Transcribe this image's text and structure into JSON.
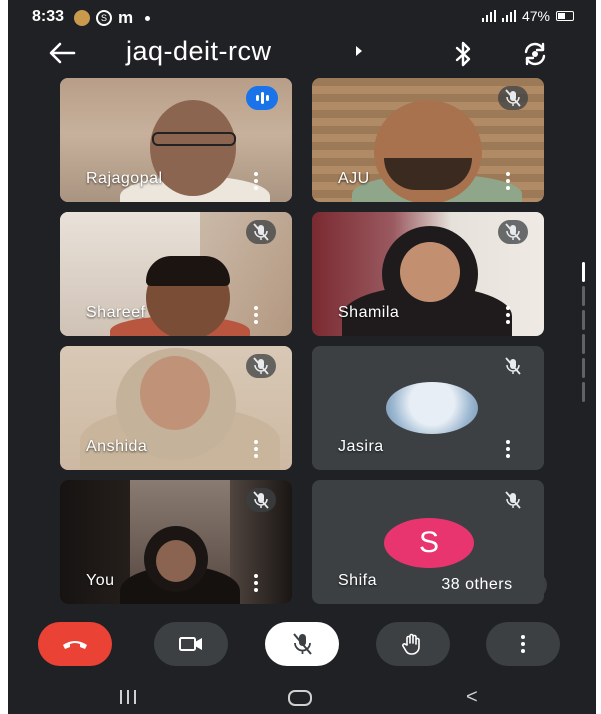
{
  "status_bar": {
    "time": "8:33",
    "m_icon": "m",
    "battery": "47%"
  },
  "header": {
    "title": "jaq-deit-rcw"
  },
  "participants": [
    {
      "name": "Rajagopal",
      "state": "speaking"
    },
    {
      "name": "AJU",
      "state": "muted"
    },
    {
      "name": "Shareef",
      "state": "muted"
    },
    {
      "name": "Shamila",
      "state": "muted"
    },
    {
      "name": "Anshida",
      "state": "muted"
    },
    {
      "name": "Jasira",
      "state": "muted"
    },
    {
      "name": "You",
      "state": "muted"
    },
    {
      "name": "Shifa",
      "state": "muted",
      "avatar_letter": "S"
    }
  ],
  "others_label": "38 others",
  "controls": [
    "end-call",
    "camera",
    "microphone-muted",
    "raise-hand",
    "more-options"
  ],
  "colors": {
    "background": "#202124",
    "tile": "#3c4043",
    "end_call": "#ea4335",
    "avatar_shifa": "#e8356f",
    "speaking": "#1a73e8"
  }
}
